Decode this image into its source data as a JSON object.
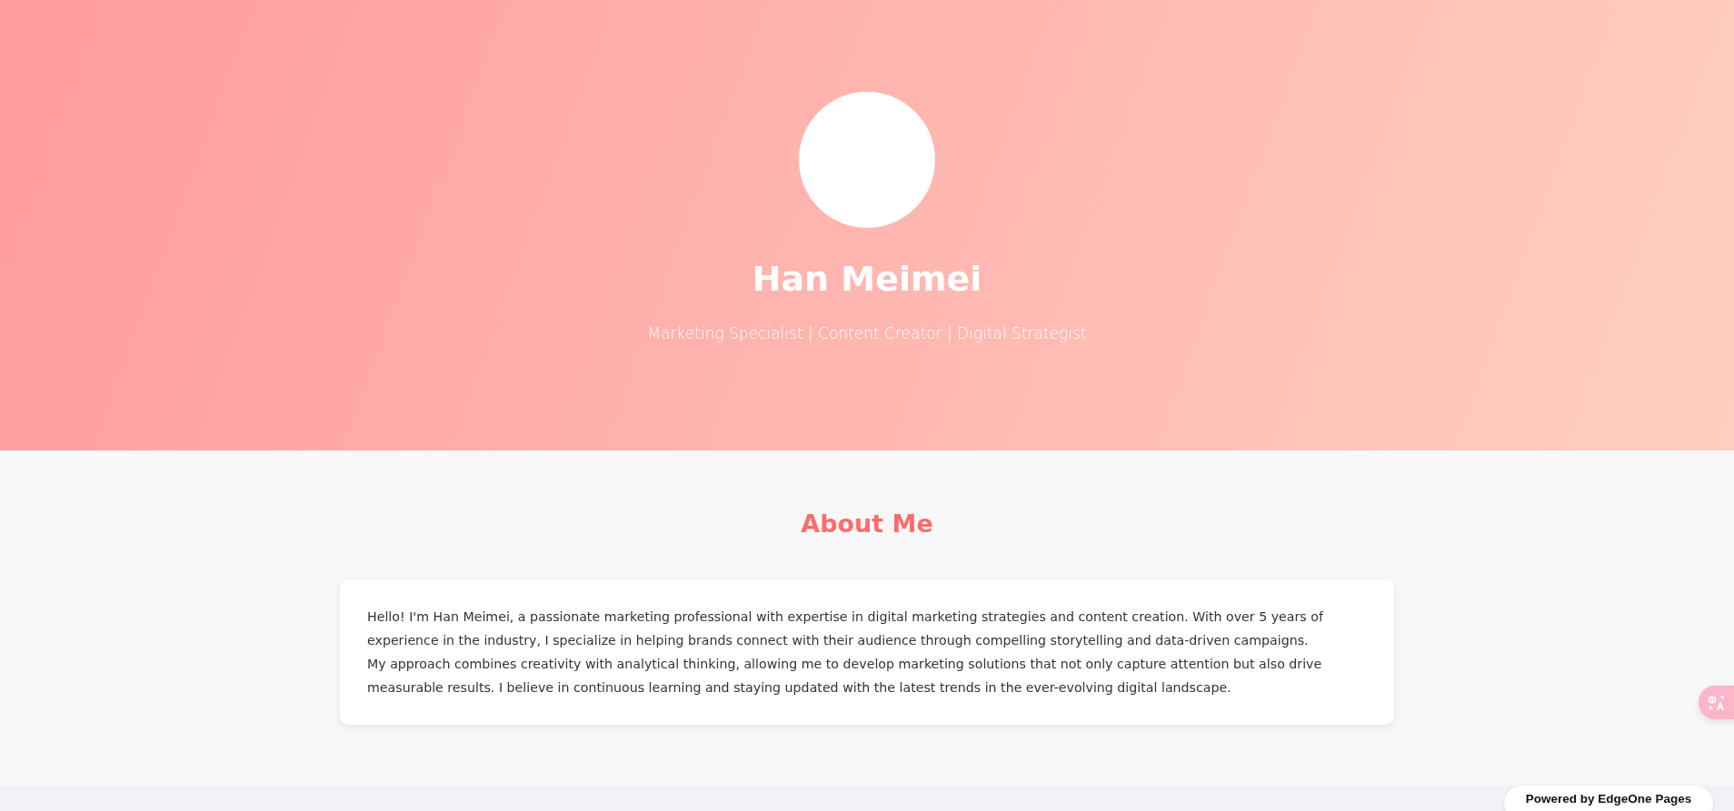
{
  "header": {
    "name": "Han Meimei",
    "tagline": "Marketing Specialist | Content Creator | Digital Strategist"
  },
  "about": {
    "heading": "About Me",
    "paragraphs": [
      "Hello! I'm Han Meimei, a passionate marketing professional with expertise in digital marketing strategies and content creation. With over 5 years of experience in the industry, I specialize in helping brands connect with their audience through compelling storytelling and data-driven campaigns.",
      "My approach combines creativity with analytical thinking, allowing me to develop marketing solutions that not only capture attention but also drive measurable results. I believe in continuous learning and staying updated with the latest trends in the ever-evolving digital landscape."
    ]
  },
  "badge": {
    "label": "Powered by EdgeOne Pages"
  }
}
